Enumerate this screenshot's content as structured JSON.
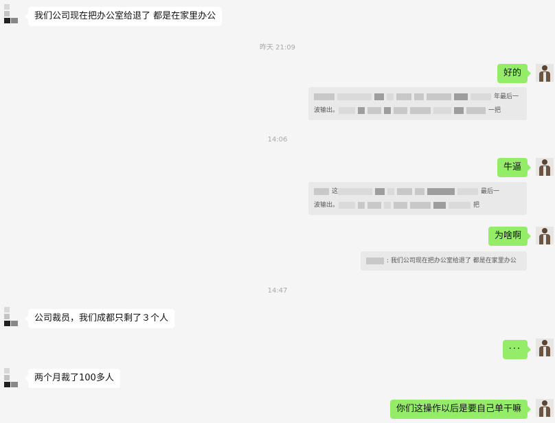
{
  "messages": {
    "m1": "我们公司现在把办公室给退了 都是在家里办公",
    "m2": "好的",
    "m3": "牛逼",
    "m4": "为啥啊",
    "m5": "公司裁员，我们成都只剩了３个人",
    "m6": "···",
    "m7": "两个月裁了100多人",
    "m8": "你们这操作以后是要自己单干嘛"
  },
  "quotes": {
    "q1_line1_start": "",
    "q1_line1_end": "年最后一",
    "q1_line2_start": "波输出。",
    "q1_line2_end": "一把",
    "q2_line1_start": "这",
    "q2_line1_end": "最后一",
    "q2_line2_start": "波输出。",
    "q2_line2_end": "把",
    "q3_text": ": 我们公司现在把办公室给退了 都是在家里办公"
  },
  "timestamps": {
    "t1": "昨天 21:09",
    "t2": "14:06",
    "t3": "14:47"
  },
  "colors": {
    "background": "#f5f5f5",
    "incoming_bubble": "#ffffff",
    "outgoing_bubble": "#95ec69",
    "timestamp": "#a8a8a8"
  }
}
